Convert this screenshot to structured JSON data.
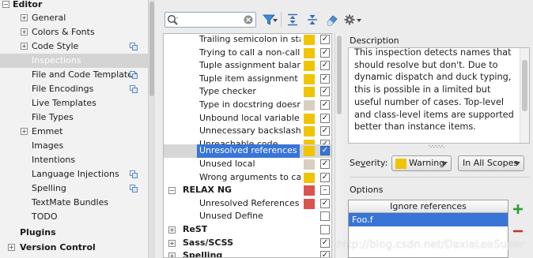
{
  "settings_tree": {
    "editor": "Editor",
    "general": "General",
    "colors_fonts": "Colors & Fonts",
    "code_style": "Code Style",
    "inspections": "Inspections",
    "file_code_templates": "File and Code Templates",
    "file_encodings": "File Encodings",
    "live_templates": "Live Templates",
    "file_types": "File Types",
    "emmet": "Emmet",
    "images": "Images",
    "intentions": "Intentions",
    "language_injections": "Language Injections",
    "spelling": "Spelling",
    "textmate_bundles": "TextMate Bundles",
    "todo": "TODO",
    "plugins": "Plugins",
    "version_control": "Version Control"
  },
  "inspections": {
    "rows": [
      {
        "label": "Trailing semicolon in sta",
        "severity_color": "#f0c400",
        "checked": true
      },
      {
        "label": "Trying to call a non-calla",
        "severity_color": "#f0c400",
        "checked": true
      },
      {
        "label": "Tuple assignment balanc",
        "severity_color": "#f0c400",
        "checked": true
      },
      {
        "label": "Tuple item assignment",
        "severity_color": "#f0c400",
        "checked": true
      },
      {
        "label": "Type checker",
        "severity_color": "#f0c400",
        "checked": true
      },
      {
        "label": "Type in docstring doesn'",
        "severity_color": "#d8cfc0",
        "checked": true
      },
      {
        "label": "Unbound local variable",
        "severity_color": "#f0c400",
        "checked": true
      },
      {
        "label": "Unnecessary backslash",
        "severity_color": "#f0c400",
        "checked": true
      },
      {
        "label": "Unreachable code",
        "severity_color": "#f0c400",
        "checked": true
      },
      {
        "label": "Unresolved references",
        "severity_color": "#f0c400",
        "checked": true
      },
      {
        "label": "Unused local",
        "severity_color": "#d8cfc0",
        "checked": true
      },
      {
        "label": "Wrong arguments to call",
        "severity_color": "#f0c400",
        "checked": true
      },
      {
        "label": "RELAX NG",
        "severity_color": "#d9534f",
        "checked": "partial"
      },
      {
        "label": "Unresolved References",
        "severity_color": "#d9534f",
        "checked": true
      },
      {
        "label": "Unused Define",
        "severity_color": "",
        "checked": false
      },
      {
        "label": "ReST",
        "severity_color": "",
        "checked": false
      },
      {
        "label": "Sass/SCSS",
        "severity_color": "",
        "checked": true
      },
      {
        "label": "Spelling",
        "severity_color": "",
        "checked": true
      }
    ],
    "check_mark": "✓",
    "partial_mark": "–"
  },
  "description": {
    "label": "Description",
    "text": "This inspection detects names that should resolve but don't. Due to dynamic dispatch and duck typing, this is possible in a limited but useful number of cases. Top-level and class-level items are supported better than instance items."
  },
  "severity": {
    "label_pre": "Se",
    "label_accel": "v",
    "label_post": "erity:",
    "value": "Warning",
    "color": "#f0c400",
    "scope": "In All Scopes"
  },
  "options": {
    "label": "Options",
    "column_header": "Ignore references",
    "rows": [
      "Foo.f"
    ],
    "add": "+",
    "remove": "−"
  },
  "watermark": "http://blog.csdn.net/DaxiaLeeSuper",
  "colors": {
    "selection": "#3875d7",
    "add_green": "#2e9e2e",
    "remove_red": "#d32f2f"
  }
}
